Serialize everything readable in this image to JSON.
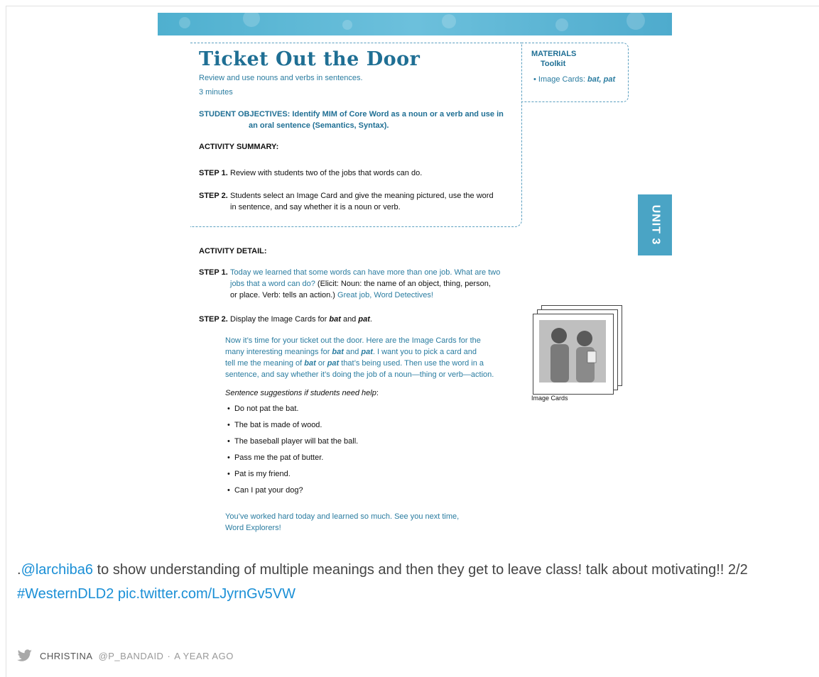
{
  "doc": {
    "title": "Ticket Out the Door",
    "subtitle": "Review and use nouns and verbs in sentences.",
    "minutes": "3 minutes",
    "objectives_label": "STUDENT OBJECTIVES:",
    "objectives_line1": "Identify MIM of Core Word as a noun or a verb and use in",
    "objectives_line2": "an oral sentence (Semantics, Syntax).",
    "materials_title": "MATERIALS",
    "materials_toolkit": "Toolkit",
    "materials_item_prefix": "•  Image Cards: ",
    "materials_item_words": "bat, pat",
    "summary_heading": "ACTIVITY SUMMARY:",
    "summary_step1_label": "STEP 1.",
    "summary_step1_text": "Review with students two of the jobs that words can do.",
    "summary_step2_label": "STEP 2.",
    "summary_step2_line1": "Students select an Image Card and give the meaning pictured, use the word",
    "summary_step2_line2": "in sentence, and say whether it is a noun or verb.",
    "unit_tab": "UNIT 3",
    "detail_heading": "ACTIVITY DETAIL:",
    "detail_step1_label": "STEP 1.",
    "detail_step1_line1": "Today we learned that some words can have more than one job. What are two",
    "detail_step1_line2a": "jobs that a word can do?",
    "detail_step1_line2b": " (Elicit: Noun: the name of an object, thing, person,",
    "detail_step1_line3a": "or place. Verb: tells an action.) ",
    "detail_step1_line3b": "Great job, Word Detectives!",
    "detail_step2_label": "STEP 2.",
    "detail_step2_text_a": "Display the Image Cards for ",
    "detail_step2_word1": "bat",
    "detail_step2_text_b": " and ",
    "detail_step2_word2": "pat",
    "detail_step2_text_c": ".",
    "para_line1": "Now it’s time for your ticket out the door. Here are the Image Cards for the",
    "para_line2a": "many interesting meanings for ",
    "para_line2_bat": "bat",
    "para_line2b": " and ",
    "para_line2_pat": "pat",
    "para_line2c": ". I want you to pick a card and",
    "para_line3a": "tell me the meaning of ",
    "para_line3_bat": "bat",
    "para_line3b": " or ",
    "para_line3_pat": "pat",
    "para_line3c": " that’s being used. Then use the word in a",
    "para_line4": "sentence, and say whether it’s doing the job of a noun—thing or verb—action.",
    "suggestions_label": "Sentence suggestions if students need help",
    "suggestions_colon": ":",
    "bullets": [
      "Do not pat the bat.",
      "The bat is made of wood.",
      "The baseball player will bat the ball.",
      "Pass me the pat of butter.",
      "Pat is my friend.",
      "Can I pat your dog?"
    ],
    "closing_line1": "You’ve worked hard today and learned so much. See you next time,",
    "closing_line2": "Word Explorers!",
    "image_caption": "Image Cards"
  },
  "tweet": {
    "prefix": ".",
    "mention": "@larchiba6",
    "body": " to show understanding of multiple meanings and then they get to leave class! talk about motivating!! 2/2 ",
    "hashtag": "#WesternDLD2",
    "link": "pic.twitter.com/LJyrnGv5VW",
    "author": "CHRISTINA",
    "handle": "@P_BANDAID",
    "separator": "·",
    "time": "A YEAR AGO"
  },
  "colors": {
    "accent_blue": "#1f6f94",
    "text_blue": "#2a7ca0",
    "link_blue": "#1a8fd6",
    "unit_tab": "#4aa4c5"
  },
  "icons": [
    "twitter-bird-icon"
  ]
}
